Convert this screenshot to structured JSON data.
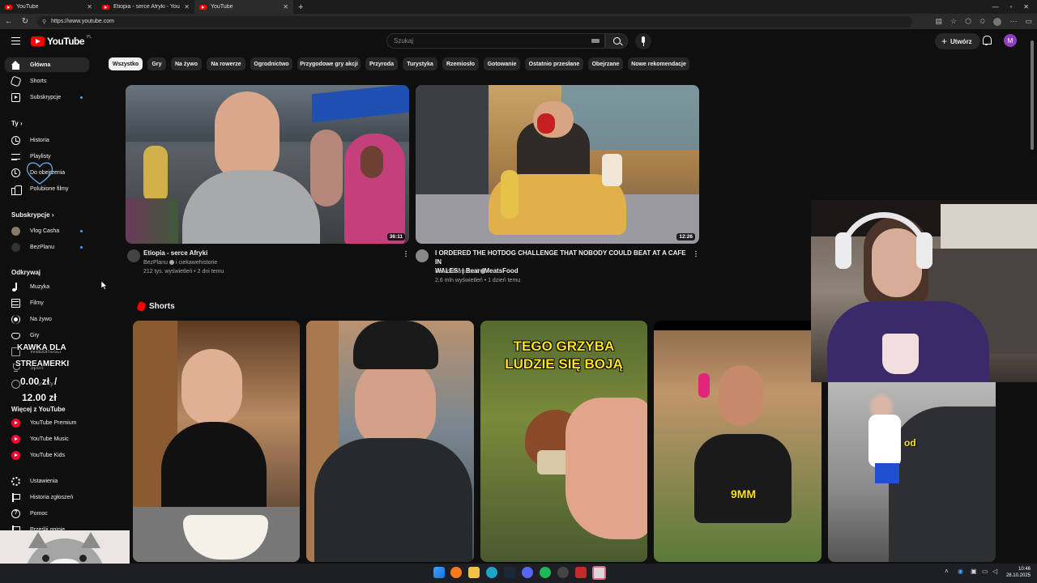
{
  "browser": {
    "tabs": [
      {
        "title": "YouTube",
        "active": false
      },
      {
        "title": "Etiopia - serce Afryki - YouTube",
        "active": false
      },
      {
        "title": "YouTube",
        "active": true
      }
    ],
    "url": "https://www.youtube.com"
  },
  "header": {
    "logo_text": "YouTube",
    "country_code": "PL",
    "search_placeholder": "Szukaj",
    "create_label": "Utwórz",
    "avatar_letter": "M"
  },
  "sidebar": {
    "main": [
      {
        "label": "Główna",
        "icon": "home-icon",
        "active": true
      },
      {
        "label": "Shorts",
        "icon": "shorts-icon"
      },
      {
        "label": "Subskrypcje",
        "icon": "subscriptions-icon",
        "dot": true
      }
    ],
    "you_heading": "Ty",
    "you": [
      {
        "label": "Historia",
        "icon": "history-icon"
      },
      {
        "label": "Playlisty",
        "icon": "playlist-icon"
      },
      {
        "label": "Do obejrzenia",
        "icon": "watch-later-icon"
      },
      {
        "label": "Polubione filmy",
        "icon": "liked-icon"
      }
    ],
    "subs_heading": "Subskrypcje",
    "subs": [
      {
        "label": "Vlog Casha",
        "dot": true
      },
      {
        "label": "BezPlanu",
        "dot": true
      }
    ],
    "explore_heading": "Odkrywaj",
    "explore": [
      {
        "label": "Muzyka",
        "icon": "music-icon"
      },
      {
        "label": "Filmy",
        "icon": "film-icon"
      },
      {
        "label": "Na żywo",
        "icon": "live-icon"
      },
      {
        "label": "Gry",
        "icon": "gaming-icon"
      },
      {
        "label": "Wiadomości",
        "icon": "news-icon"
      },
      {
        "label": "Sport",
        "icon": "trophy-icon"
      },
      {
        "label": "Podcasty",
        "icon": "podcast-icon"
      }
    ],
    "more_heading": "Więcej z YouTube",
    "more": [
      {
        "label": "YouTube Premium"
      },
      {
        "label": "YouTube Music"
      },
      {
        "label": "YouTube Kids"
      }
    ],
    "footer": [
      {
        "label": "Ustawienia",
        "icon": "settings-icon"
      },
      {
        "label": "Historia zgłoszeń",
        "icon": "flag-icon"
      },
      {
        "label": "Pomoc",
        "icon": "help-icon"
      },
      {
        "label": "Prześlij opinię",
        "icon": "feedback-icon"
      }
    ]
  },
  "donation_overlay": {
    "title_line1": "KAWKA DLA",
    "title_line2": "STREAMERKI",
    "current": "0.00 zł",
    "separator": "/",
    "goal": "12.00 zł"
  },
  "chips": [
    "Wszystko",
    "Gry",
    "Na żywo",
    "Na rowerze",
    "Ogrodnictwo",
    "Przygodowe gry akcji",
    "Przyroda",
    "Turystyka",
    "Rzemiosło",
    "Gotowanie",
    "Ostatnio przesłane",
    "Obejrzane",
    "Nowe rekomendacje"
  ],
  "videos": [
    {
      "title": "Etiopia - serce Afryki",
      "channel": "BezPlanu",
      "channel_extra": "i ciekawehistorie",
      "meta": "212 tys. wyświetleń • 2 dni temu",
      "duration": "36:11"
    },
    {
      "title_line1": "I ORDERED THE HOTDOG CHALLENGE THAT NOBODY COULD BEAT AT A CAFE IN",
      "title_line2": "WALES! | BeardMeatsFood",
      "channel": "BeardMeatsFood",
      "meta": "2,6 mln wyświetleń • 1 dzień temu",
      "duration": "12:26"
    }
  ],
  "shorts": {
    "heading": "Shorts",
    "items": [
      {
        "overlay": ""
      },
      {
        "overlay": ""
      },
      {
        "overlay_line1": "TEGO GRZYBA",
        "overlay_line2": "LUDZIE SIĘ BOJĄ"
      },
      {
        "overlay": "9MM"
      },
      {
        "overlay": "od"
      }
    ]
  },
  "taskbar": {
    "time": "10:46",
    "date": "28.10.2025"
  }
}
